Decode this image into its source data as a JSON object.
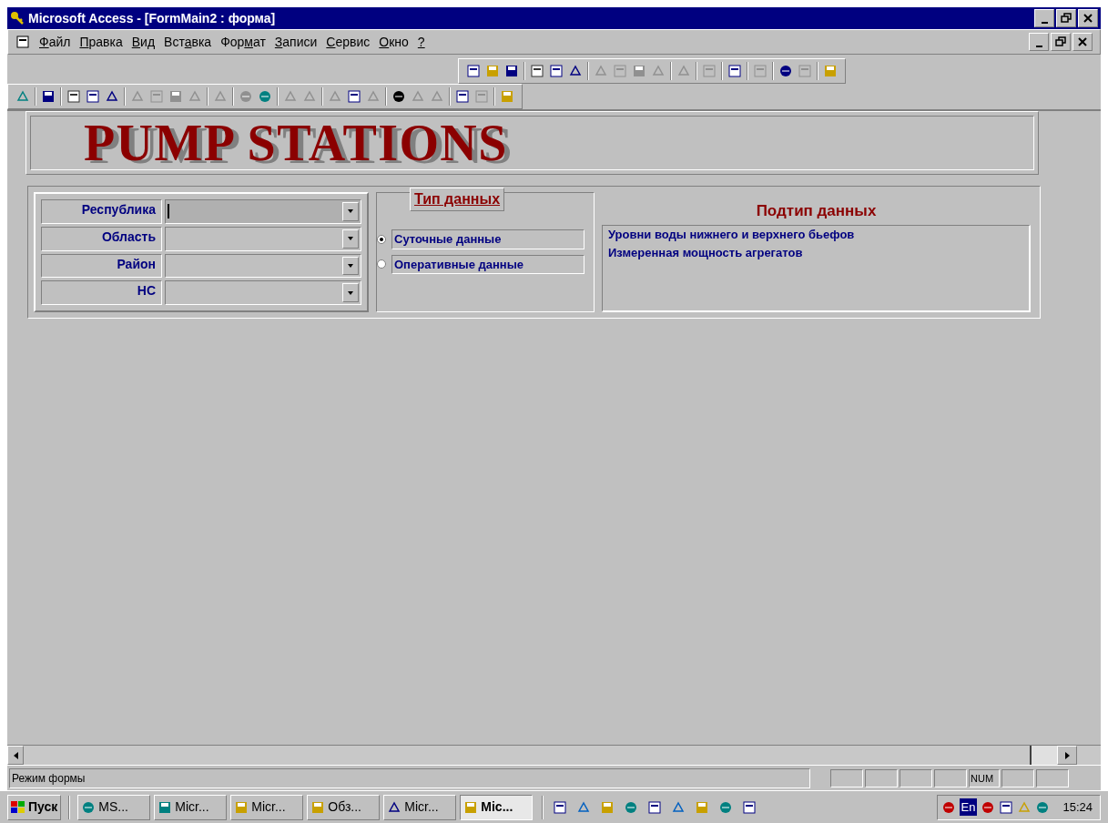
{
  "window": {
    "title": "Microsoft Access - [FormMain2 : форма]"
  },
  "menu": [
    {
      "key": "Ф",
      "after": "айл"
    },
    {
      "key": "П",
      "after": "равка"
    },
    {
      "key": "В",
      "after": "ид"
    },
    {
      "before": "Вст",
      "key": "а",
      "after": "вка"
    },
    {
      "before": "Фор",
      "key": "м",
      "after": "ат"
    },
    {
      "key": "З",
      "after": "аписи"
    },
    {
      "key": "С",
      "after": "ервис"
    },
    {
      "key": "О",
      "after": "кно"
    },
    {
      "key": "?"
    }
  ],
  "form": {
    "header": "PUMP STATIONS",
    "filters": [
      {
        "label": "Республика",
        "focused": true
      },
      {
        "label": "Область",
        "focused": false
      },
      {
        "label": "Район",
        "focused": false
      },
      {
        "label": "НС",
        "focused": false
      }
    ],
    "data_type": {
      "title": "Тип данных",
      "options": [
        {
          "label": "Суточные данные",
          "selected": true
        },
        {
          "label": "Оперативные данные",
          "selected": false
        }
      ]
    },
    "data_subtype": {
      "title": "Подтип данных",
      "items": [
        "Уровни воды нижнего и верхнего бьефов",
        "Измеренная мощность агрегатов"
      ]
    }
  },
  "status_bar": {
    "text": "Режим формы",
    "indicator": "NUM"
  },
  "taskbar": {
    "start": "Пуск",
    "tasks": [
      {
        "label": "MS...",
        "selected": false
      },
      {
        "label": "Micr...",
        "selected": false
      },
      {
        "label": "Micr...",
        "selected": false
      },
      {
        "label": "Обз...",
        "selected": false
      },
      {
        "label": "Micr...",
        "selected": false
      },
      {
        "label": "Mic...",
        "selected": true
      }
    ],
    "language": "En",
    "clock": "15:24"
  }
}
